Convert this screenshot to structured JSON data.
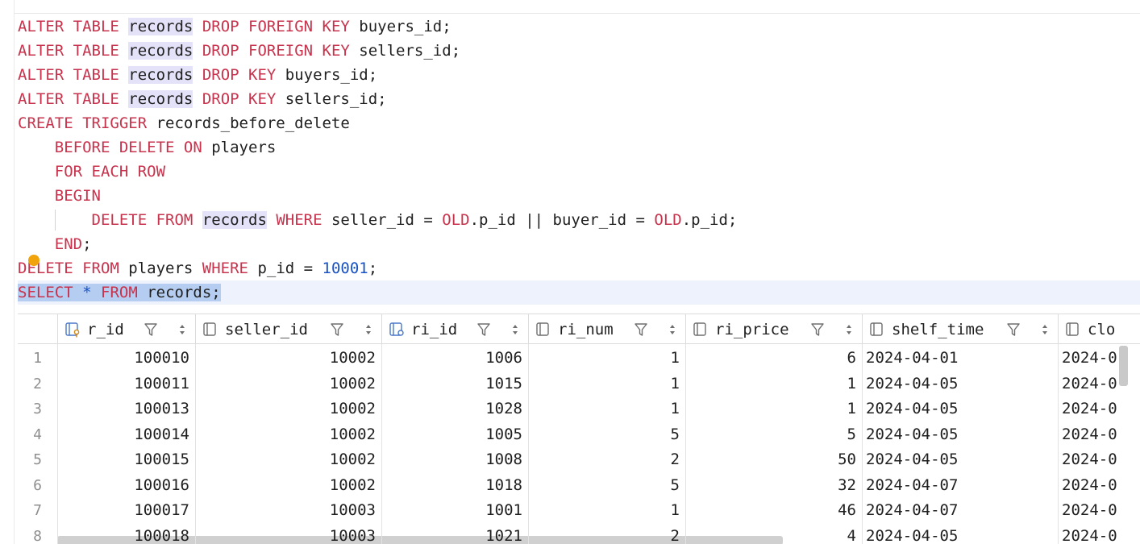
{
  "editor": {
    "lines": [
      [
        {
          "t": "ALTER TABLE",
          "c": "kw"
        },
        {
          "t": " "
        },
        {
          "t": "records",
          "c": "hl"
        },
        {
          "t": " "
        },
        {
          "t": "DROP FOREIGN KEY",
          "c": "kw"
        },
        {
          "t": " buyers_id;"
        }
      ],
      [
        {
          "t": "ALTER TABLE",
          "c": "kw"
        },
        {
          "t": " "
        },
        {
          "t": "records",
          "c": "hl"
        },
        {
          "t": " "
        },
        {
          "t": "DROP FOREIGN KEY",
          "c": "kw"
        },
        {
          "t": " sellers_id;"
        }
      ],
      [
        {
          "t": "ALTER TABLE",
          "c": "kw"
        },
        {
          "t": " "
        },
        {
          "t": "records",
          "c": "hl"
        },
        {
          "t": " "
        },
        {
          "t": "DROP KEY",
          "c": "kw"
        },
        {
          "t": " buyers_id;"
        }
      ],
      [
        {
          "t": "ALTER TABLE",
          "c": "kw"
        },
        {
          "t": " "
        },
        {
          "t": "records",
          "c": "hl"
        },
        {
          "t": " "
        },
        {
          "t": "DROP KEY",
          "c": "kw"
        },
        {
          "t": " sellers_id;"
        }
      ],
      [
        {
          "t": "CREATE TRIGGER",
          "c": "kw"
        },
        {
          "t": " records_before_delete"
        }
      ],
      [
        {
          "t": "    "
        },
        {
          "t": "BEFORE DELETE ON",
          "c": "kw"
        },
        {
          "t": " players"
        }
      ],
      [
        {
          "t": "    "
        },
        {
          "t": "FOR EACH ROW",
          "c": "kw"
        }
      ],
      [
        {
          "t": "    "
        },
        {
          "t": "BEGIN",
          "c": "kw"
        }
      ],
      [
        {
          "t": "        "
        },
        {
          "t": "DELETE FROM",
          "c": "kw"
        },
        {
          "t": " "
        },
        {
          "t": "records",
          "c": "hl"
        },
        {
          "t": " "
        },
        {
          "t": "WHERE",
          "c": "kw"
        },
        {
          "t": " seller_id = "
        },
        {
          "t": "OLD",
          "c": "kw"
        },
        {
          "t": ".p_id || buyer_id = "
        },
        {
          "t": "OLD",
          "c": "kw"
        },
        {
          "t": ".p_id;"
        }
      ],
      [
        {
          "t": "    "
        },
        {
          "t": "END",
          "c": "kw"
        },
        {
          "t": ";"
        }
      ],
      [
        {
          "t": "DELETE FROM",
          "c": "kw"
        },
        {
          "t": " players "
        },
        {
          "t": "WHERE",
          "c": "kw"
        },
        {
          "t": " p_id = "
        },
        {
          "t": "10001",
          "c": "num"
        },
        {
          "t": ";"
        }
      ],
      [
        {
          "t": "SELECT",
          "c": "kw sel-text"
        },
        {
          "t": " ",
          "c": "sel-text"
        },
        {
          "t": "*",
          "c": "num sel-text"
        },
        {
          "t": " ",
          "c": "sel-text"
        },
        {
          "t": "FROM",
          "c": "kw sel-text"
        },
        {
          "t": " records;",
          "c": "sel-text"
        }
      ]
    ]
  },
  "grid": {
    "columns": [
      {
        "name": "r_id",
        "icon": "primary-key-column-icon",
        "align": "r",
        "filter": true,
        "sort": true
      },
      {
        "name": "seller_id",
        "icon": "column-icon",
        "align": "r",
        "filter": true,
        "sort": true
      },
      {
        "name": "ri_id",
        "icon": "index-column-icon",
        "align": "r",
        "filter": true,
        "sort": true
      },
      {
        "name": "ri_num",
        "icon": "column-icon",
        "align": "r",
        "filter": true,
        "sort": true
      },
      {
        "name": "ri_price",
        "icon": "column-icon",
        "align": "r",
        "filter": true,
        "sort": true
      },
      {
        "name": "shelf_time",
        "icon": "column-icon",
        "align": "l",
        "filter": true,
        "sort": true
      },
      {
        "name": "clo",
        "icon": "column-icon",
        "align": "l",
        "filter": false,
        "sort": false
      }
    ],
    "rows": [
      {
        "n": "1",
        "cells": [
          "100010",
          "10002",
          "1006",
          "1",
          "6",
          "2024-04-01",
          "2024-0"
        ]
      },
      {
        "n": "2",
        "cells": [
          "100011",
          "10002",
          "1015",
          "1",
          "1",
          "2024-04-05",
          "2024-0"
        ]
      },
      {
        "n": "3",
        "cells": [
          "100013",
          "10002",
          "1028",
          "1",
          "1",
          "2024-04-05",
          "2024-0"
        ]
      },
      {
        "n": "4",
        "cells": [
          "100014",
          "10002",
          "1005",
          "5",
          "5",
          "2024-04-05",
          "2024-0"
        ]
      },
      {
        "n": "5",
        "cells": [
          "100015",
          "10002",
          "1008",
          "2",
          "50",
          "2024-04-05",
          "2024-0"
        ]
      },
      {
        "n": "6",
        "cells": [
          "100016",
          "10002",
          "1018",
          "5",
          "32",
          "2024-04-07",
          "2024-0"
        ]
      },
      {
        "n": "7",
        "cells": [
          "100017",
          "10003",
          "1001",
          "1",
          "46",
          "2024-04-07",
          "2024-0"
        ]
      },
      {
        "n": "8",
        "cells": [
          "100018",
          "10003",
          "1021",
          "2",
          "4",
          "2024-04-05",
          "2024-0"
        ]
      }
    ]
  }
}
